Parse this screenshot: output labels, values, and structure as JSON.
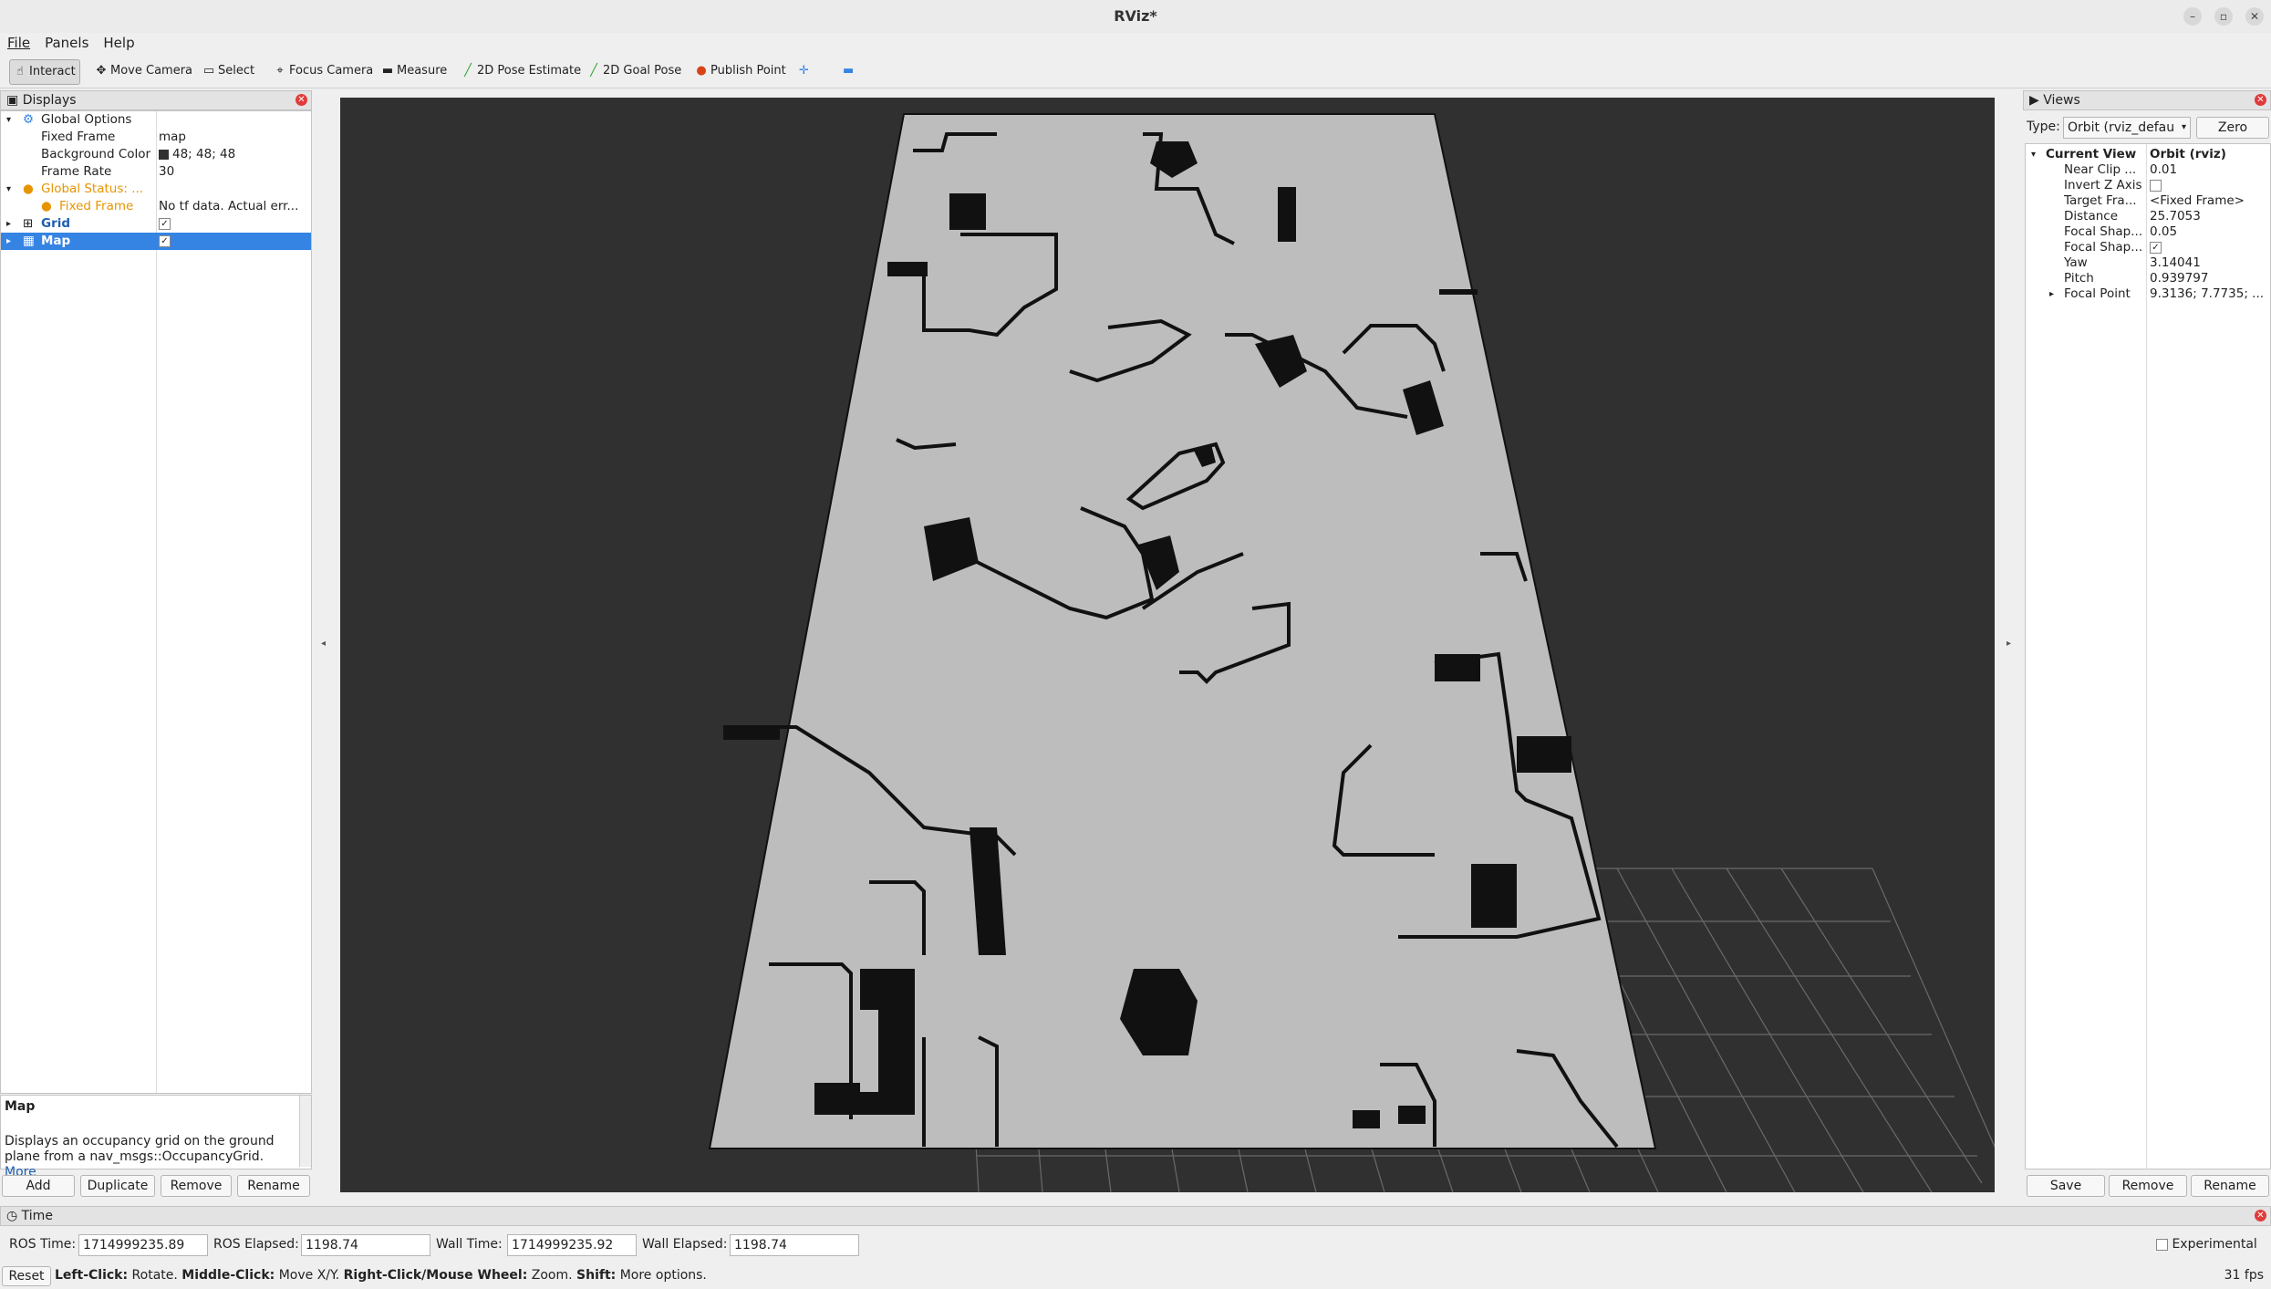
{
  "window": {
    "title": "RViz*"
  },
  "menu": [
    "File",
    "Panels",
    "Help"
  ],
  "toolbar": {
    "interact": "Interact",
    "move_camera": "Move Camera",
    "select": "Select",
    "focus_camera": "Focus Camera",
    "measure": "Measure",
    "pose_estimate": "2D Pose Estimate",
    "goal_pose": "2D Goal Pose",
    "publish_point": "Publish Point"
  },
  "displays": {
    "title": "Displays",
    "rows": [
      {
        "label": "Global Options",
        "value": ""
      },
      {
        "label": "Fixed Frame",
        "value": "map"
      },
      {
        "label": "Background Color",
        "value": "48; 48; 48"
      },
      {
        "label": "Frame Rate",
        "value": "30"
      },
      {
        "label": "Global Status: ...",
        "value": ""
      },
      {
        "label": "Fixed Frame",
        "value": "No tf data.  Actual err..."
      },
      {
        "label": "Grid",
        "value": "✓"
      },
      {
        "label": "Map",
        "value": "✓"
      }
    ],
    "description_title": "Map",
    "description_text": "Displays an occupancy grid on the ground plane from a nav_msgs::OccupancyGrid.",
    "description_more": "More",
    "buttons": {
      "add": "Add",
      "duplicate": "Duplicate",
      "remove": "Remove",
      "rename": "Rename"
    }
  },
  "views": {
    "title": "Views",
    "type_label": "Type:",
    "type_value": "Orbit (rviz_defau",
    "zero": "Zero",
    "rows": [
      {
        "label": "Current View",
        "value": "Orbit (rviz)"
      },
      {
        "label": "Near Clip ...",
        "value": "0.01"
      },
      {
        "label": "Invert Z Axis",
        "value": ""
      },
      {
        "label": "Target Fra...",
        "value": "<Fixed Frame>"
      },
      {
        "label": "Distance",
        "value": "25.7053"
      },
      {
        "label": "Focal Shap...",
        "value": "0.05"
      },
      {
        "label": "Focal Shap...",
        "value": "✓"
      },
      {
        "label": "Yaw",
        "value": "3.14041"
      },
      {
        "label": "Pitch",
        "value": "0.939797"
      },
      {
        "label": "Focal Point",
        "value": "9.3136; 7.7735; ..."
      }
    ],
    "buttons": {
      "save": "Save",
      "remove": "Remove",
      "rename": "Rename"
    }
  },
  "time": {
    "title": "Time",
    "ros_time_label": "ROS Time:",
    "ros_time": "1714999235.89",
    "ros_elapsed_label": "ROS Elapsed:",
    "ros_elapsed": "1198.74",
    "wall_time_label": "Wall Time:",
    "wall_time": "1714999235.92",
    "wall_elapsed_label": "Wall Elapsed:",
    "wall_elapsed": "1198.74",
    "experimental": "Experimental"
  },
  "status": {
    "reset": "Reset",
    "left": "Left-Click:",
    "left_t": " Rotate. ",
    "middle": "Middle-Click:",
    "middle_t": " Move X/Y. ",
    "right": "Right-Click/Mouse Wheel:",
    "right_t": " Zoom. ",
    "shift": "Shift:",
    "shift_t": " More options.",
    "fps": "31 fps"
  },
  "colors": {
    "viewport_bg": "#303030",
    "map_free": "#c0c0c0",
    "selection": "#3584e4",
    "warning": "#e69500"
  }
}
